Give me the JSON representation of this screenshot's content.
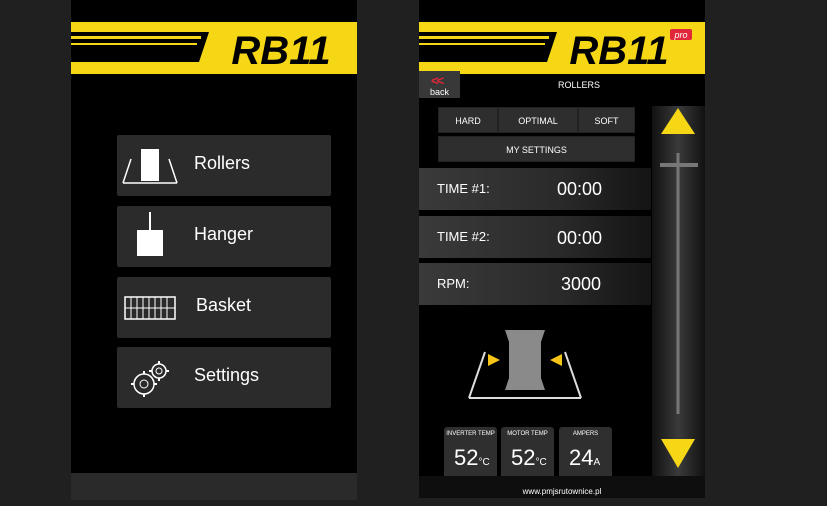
{
  "brand": {
    "logo_text": "RB11",
    "pro_badge": "pro",
    "accent": "#f5d716"
  },
  "left_menu": {
    "items": [
      {
        "label": "Rollers",
        "icon": "rollers-icon"
      },
      {
        "label": "Hanger",
        "icon": "hanger-icon"
      },
      {
        "label": "Basket",
        "icon": "basket-icon"
      },
      {
        "label": "Settings",
        "icon": "gear-icon"
      }
    ]
  },
  "rollers": {
    "back_chevron": "<<",
    "back_label": "back",
    "title": "ROLLERS",
    "modes": [
      "HARD",
      "OPTIMAL",
      "SOFT"
    ],
    "my_settings": "MY SETTINGS",
    "time1": {
      "label": "TIME #1:",
      "value": "00:00"
    },
    "time2": {
      "label": "TIME #2:",
      "value": "00:00"
    },
    "rpm": {
      "label": "RPM:",
      "value": "3000"
    },
    "gauges": [
      {
        "label": "INVERTER TEMP",
        "value": "52",
        "unit": "°C"
      },
      {
        "label": "MOTOR TEMP",
        "value": "52",
        "unit": "°C"
      },
      {
        "label": "AMPERS",
        "value": "24",
        "unit": "A"
      }
    ],
    "website": "www.pmjsrutownice.pl"
  }
}
